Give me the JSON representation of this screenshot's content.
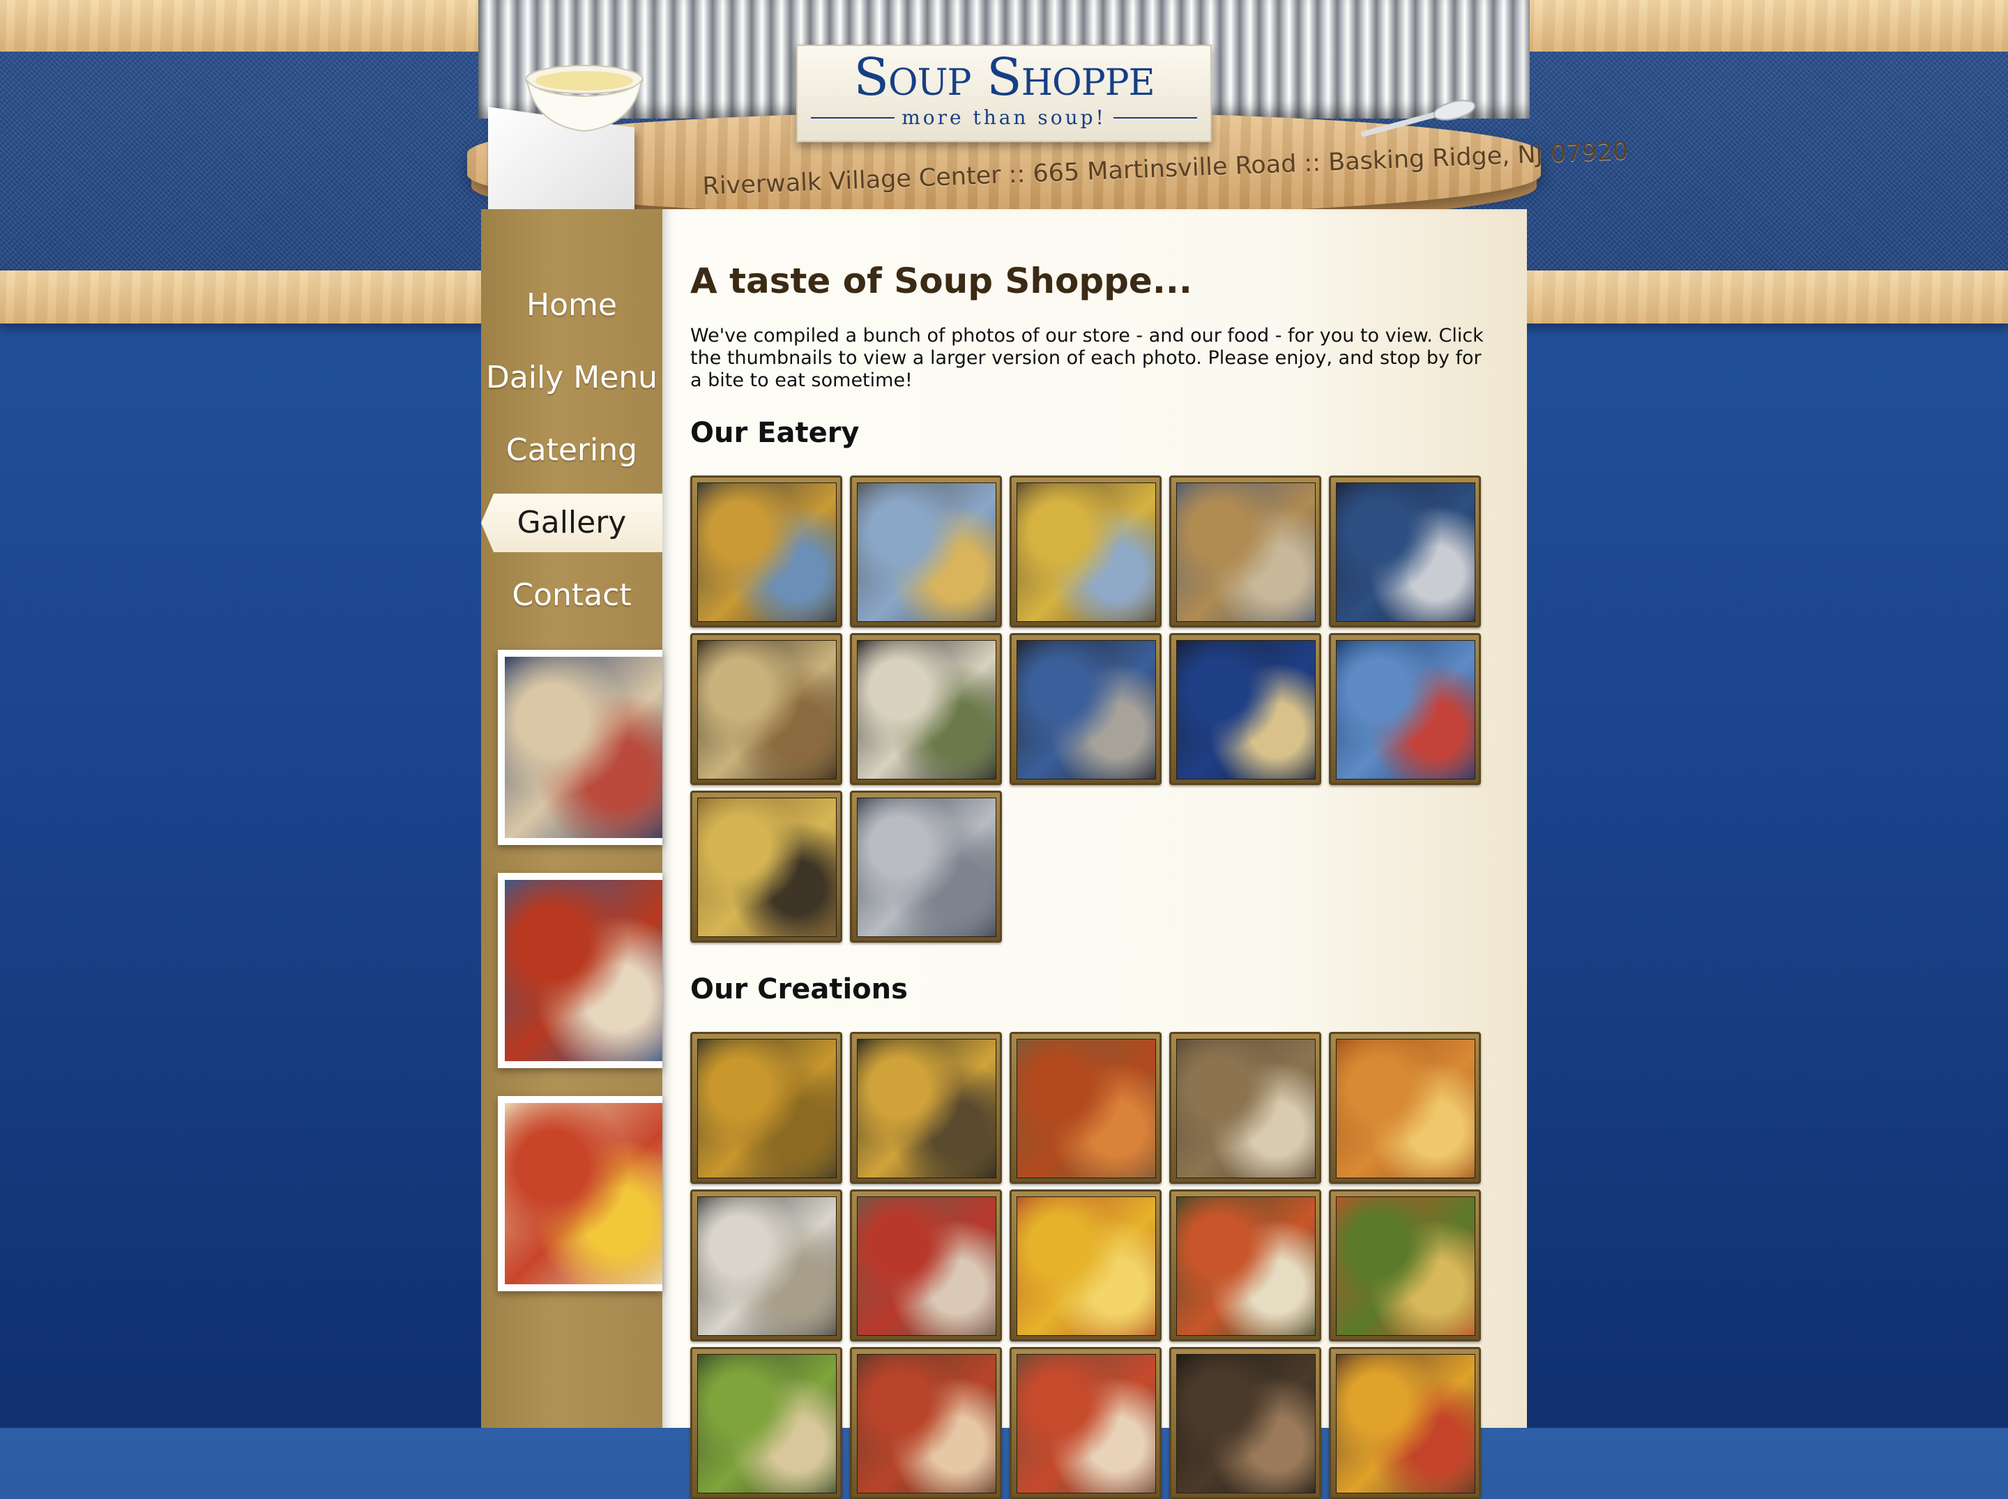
{
  "site": {
    "logo_title": "Soup Shoppe",
    "logo_tagline": "more than soup!",
    "address": "Riverwalk Village Center :: 665 Martinsville Road :: Basking Ridge, NJ 07920"
  },
  "nav": {
    "items": [
      {
        "label": "Home"
      },
      {
        "label": "Daily Menu"
      },
      {
        "label": "Catering"
      },
      {
        "label": "Gallery"
      },
      {
        "label": "Contact"
      }
    ],
    "active": "Gallery"
  },
  "main": {
    "title": "A taste of Soup Shoppe...",
    "intro": "We've compiled a bunch of photos of our store - and our food - for you to view. Click the thumbnails to view a larger version of each photo. Please enjoy, and stop by for a bite to eat sometime!",
    "sections": [
      {
        "title": "Our Eatery",
        "thumbs": [
          {
            "colors": [
              "#c99a36",
              "#6b8fb6",
              "#3a3a3a"
            ]
          },
          {
            "colors": [
              "#8aa7c8",
              "#d9b45a",
              "#555555"
            ]
          },
          {
            "colors": [
              "#d6b341",
              "#8fa9c8",
              "#5c4a33"
            ]
          },
          {
            "colors": [
              "#b08b52",
              "#c7b89a",
              "#4d5d78"
            ]
          },
          {
            "colors": [
              "#2d4f82",
              "#c9ccd2",
              "#1e2740"
            ]
          },
          {
            "colors": [
              "#c9b27b",
              "#8a6a3e",
              "#3a2e20"
            ]
          },
          {
            "colors": [
              "#d8d2bf",
              "#6b7a4a",
              "#2a2a2a"
            ]
          },
          {
            "colors": [
              "#3b5f9a",
              "#a8a39a",
              "#20242e"
            ]
          },
          {
            "colors": [
              "#1f3f86",
              "#d8c28a",
              "#182035"
            ]
          },
          {
            "colors": [
              "#5e8bc5",
              "#c3433a",
              "#1d3d70"
            ]
          },
          {
            "colors": [
              "#d5b553",
              "#3f3527",
              "#8a6b35"
            ]
          },
          {
            "colors": [
              "#b9bcc2",
              "#7e848f",
              "#3f4652"
            ]
          }
        ]
      },
      {
        "title": "Our Creations",
        "thumbs": [
          {
            "colors": [
              "#c9972c",
              "#8c6a22",
              "#3c3a2c"
            ]
          },
          {
            "colors": [
              "#d0a23a",
              "#5a4a2e",
              "#2a2a22"
            ]
          },
          {
            "colors": [
              "#b24a1e",
              "#d9823a",
              "#7a5a3a"
            ]
          },
          {
            "colors": [
              "#8c7450",
              "#d8cbb0",
              "#5a4a38"
            ]
          },
          {
            "colors": [
              "#d88a34",
              "#f0c76a",
              "#a0521e"
            ]
          },
          {
            "colors": [
              "#d9d5cc",
              "#a89e8a",
              "#4a4a46"
            ]
          },
          {
            "colors": [
              "#b8392c",
              "#d9c9b6",
              "#6a5a4a"
            ]
          },
          {
            "colors": [
              "#e6b32a",
              "#f3d56a",
              "#b7542a"
            ]
          },
          {
            "colors": [
              "#c9562a",
              "#e6dcc2",
              "#3c4a2a"
            ]
          },
          {
            "colors": [
              "#5a7a2a",
              "#d7b85a",
              "#c0522a"
            ]
          },
          {
            "colors": [
              "#7fa43c",
              "#d8c79a",
              "#3a4a2a"
            ]
          },
          {
            "colors": [
              "#b8442a",
              "#e6c8a6",
              "#5a3a2a"
            ]
          },
          {
            "colors": [
              "#c64a2c",
              "#e8d2b8",
              "#6a4a3a"
            ]
          },
          {
            "colors": [
              "#4a3a2a",
              "#9a7a5a",
              "#1e1a16"
            ]
          },
          {
            "colors": [
              "#e0a22a",
              "#c4442a",
              "#5a3a2a"
            ]
          }
        ]
      }
    ]
  },
  "side_photos": [
    {
      "name": "side-photo-sandwich",
      "colors": [
        "#d9c7a6",
        "#b94a3c",
        "#2e3f66"
      ]
    },
    {
      "name": "side-photo-wings",
      "colors": [
        "#b8391f",
        "#e6d7bf",
        "#3b5a8a"
      ]
    },
    {
      "name": "side-photo-breakfast",
      "colors": [
        "#c8452a",
        "#f2c83a",
        "#e8d6b2"
      ]
    }
  ]
}
